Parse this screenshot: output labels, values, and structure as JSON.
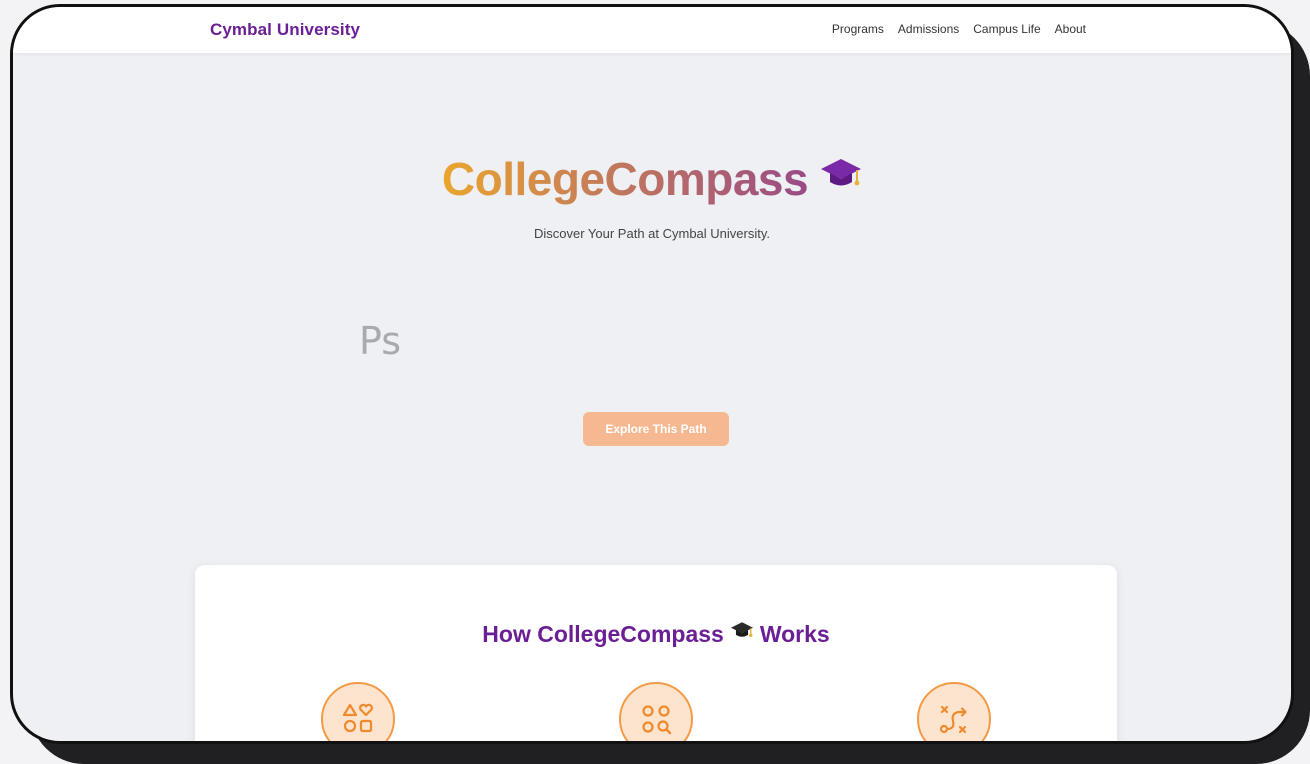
{
  "nav": {
    "brand": "Cymbal University",
    "links": [
      "Programs",
      "Admissions",
      "Campus Life",
      "About"
    ]
  },
  "hero": {
    "title": "CollegeCompass",
    "subtitle": "Discover Your Path at Cymbal University.",
    "typed_text": "Ps",
    "cta_label": "Explore This Path"
  },
  "how_it_works": {
    "title_before": "How CollegeCompass",
    "title_after": "Works",
    "steps": [
      {
        "icon": "shapes-icon"
      },
      {
        "icon": "search-grid-icon"
      },
      {
        "icon": "route-icon"
      }
    ]
  },
  "colors": {
    "brand_purple": "#6b1f95",
    "accent_orange": "#f39a46",
    "button_peach": "#f6b890",
    "page_bg": "#eef0f4"
  }
}
